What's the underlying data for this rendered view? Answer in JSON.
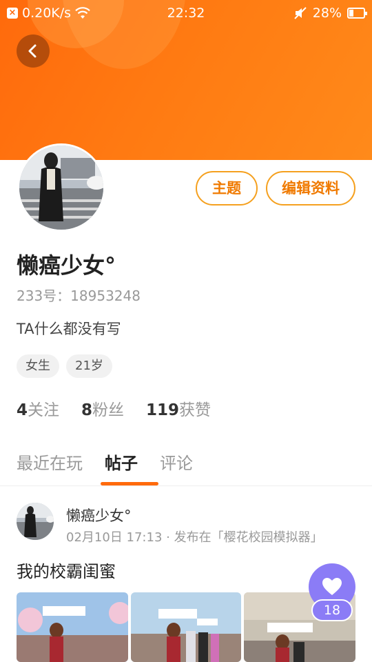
{
  "status_bar": {
    "network_speed": "0.20K/s",
    "time": "22:32",
    "battery": "28%",
    "battery_level": 0.28
  },
  "profile": {
    "buttons": {
      "topic": "主题",
      "edit": "编辑资料"
    },
    "nickname": "懒癌少女°",
    "user_id": "233号：18953248",
    "bio": "TA什么都没有写",
    "tags": {
      "gender": "女生",
      "age": "21岁"
    },
    "stats": {
      "following_count": "4",
      "following_label": "关注",
      "fans_count": "8",
      "fans_label": "粉丝",
      "likes_count": "119",
      "likes_label": "获赞"
    }
  },
  "tabs": {
    "recent": "最近在玩",
    "posts": "帖子",
    "comments": "评论"
  },
  "post": {
    "author": "懒癌少女°",
    "meta": "02月10日 17:13 · 发布在「樱花校园模拟器」",
    "title": "我的校霸闺蜜",
    "like_count": "18"
  },
  "colors": {
    "brand_orange": "#ff6a0c",
    "button_border": "#f5a01e",
    "like_purple": "#8b7cf6"
  },
  "icons": {
    "back": "back-arrow-icon",
    "wifi": "wifi-icon",
    "mute": "mute-icon",
    "battery": "battery-icon",
    "like": "heart-icon"
  }
}
